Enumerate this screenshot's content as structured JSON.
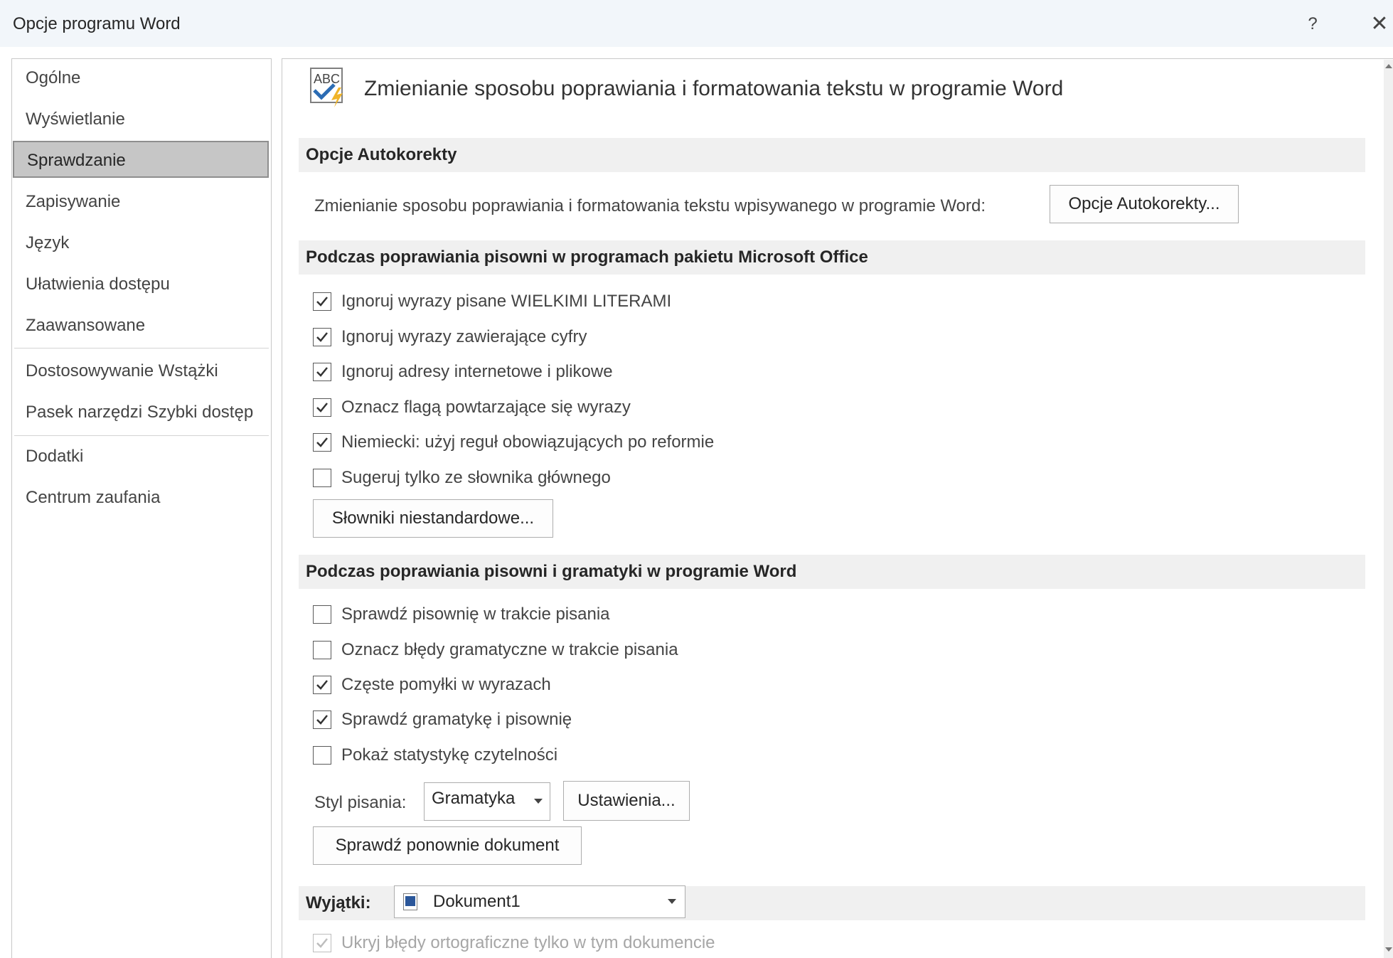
{
  "window": {
    "title": "Opcje programu Word",
    "help": "?",
    "close": "✕"
  },
  "sidebar": {
    "items": [
      {
        "label": "Ogólne"
      },
      {
        "label": "Wyświetlanie"
      },
      {
        "label": "Sprawdzanie",
        "selected": true
      },
      {
        "label": "Zapisywanie"
      },
      {
        "label": "Język"
      },
      {
        "label": "Ułatwienia dostępu"
      },
      {
        "label": "Zaawansowane"
      },
      {
        "label": "Dostosowywanie Wstążki"
      },
      {
        "label": "Pasek narzędzi Szybki dostęp"
      },
      {
        "label": "Dodatki"
      },
      {
        "label": "Centrum zaufania"
      }
    ]
  },
  "header": {
    "icon": "abc-check-icon",
    "title": "Zmienianie sposobu poprawiania i formatowania tekstu w programie Word"
  },
  "autocorrect": {
    "heading": "Opcje Autokorekty",
    "description": "Zmienianie sposobu poprawiania i formatowania tekstu wpisywanego w programie Word:",
    "button": "Opcje Autokorekty..."
  },
  "office_spelling": {
    "heading": "Podczas poprawiania pisowni w programach pakietu Microsoft Office",
    "options": [
      {
        "label": "Ignoruj wyrazy pisane WIELKIMI LITERAMI",
        "checked": true
      },
      {
        "label": "Ignoruj wyrazy zawierające cyfry",
        "checked": true
      },
      {
        "label": "Ignoruj adresy internetowe i plikowe",
        "checked": true
      },
      {
        "label": "Oznacz flagą powtarzające się wyrazy",
        "checked": true
      },
      {
        "label": "Niemiecki: użyj reguł obowiązujących po reformie",
        "checked": true
      },
      {
        "label": "Sugeruj tylko ze słownika głównego",
        "checked": false
      }
    ],
    "custom_dictionaries_button": "Słowniki niestandardowe..."
  },
  "word_spelling": {
    "heading": "Podczas poprawiania pisowni i gramatyki w programie Word",
    "options": [
      {
        "label": "Sprawdź pisownię w trakcie pisania",
        "checked": false
      },
      {
        "label": "Oznacz błędy gramatyczne w trakcie pisania",
        "checked": false
      },
      {
        "label": "Częste pomyłki w wyrazach",
        "checked": true
      },
      {
        "label": "Sprawdź gramatykę i pisownię",
        "checked": true
      },
      {
        "label": "Pokaż statystykę czytelności",
        "checked": false
      }
    ],
    "writing_style_label": "Styl pisania:",
    "writing_style_value": "Gramatyka",
    "settings_button": "Ustawienia...",
    "recheck_button": "Sprawdź ponownie dokument"
  },
  "exceptions": {
    "label": "Wyjątki:",
    "document": "Dokument1",
    "options": [
      {
        "label": "Ukryj błędy ortograficzne tylko w tym dokumencie",
        "checked": true,
        "disabled": true
      }
    ]
  }
}
